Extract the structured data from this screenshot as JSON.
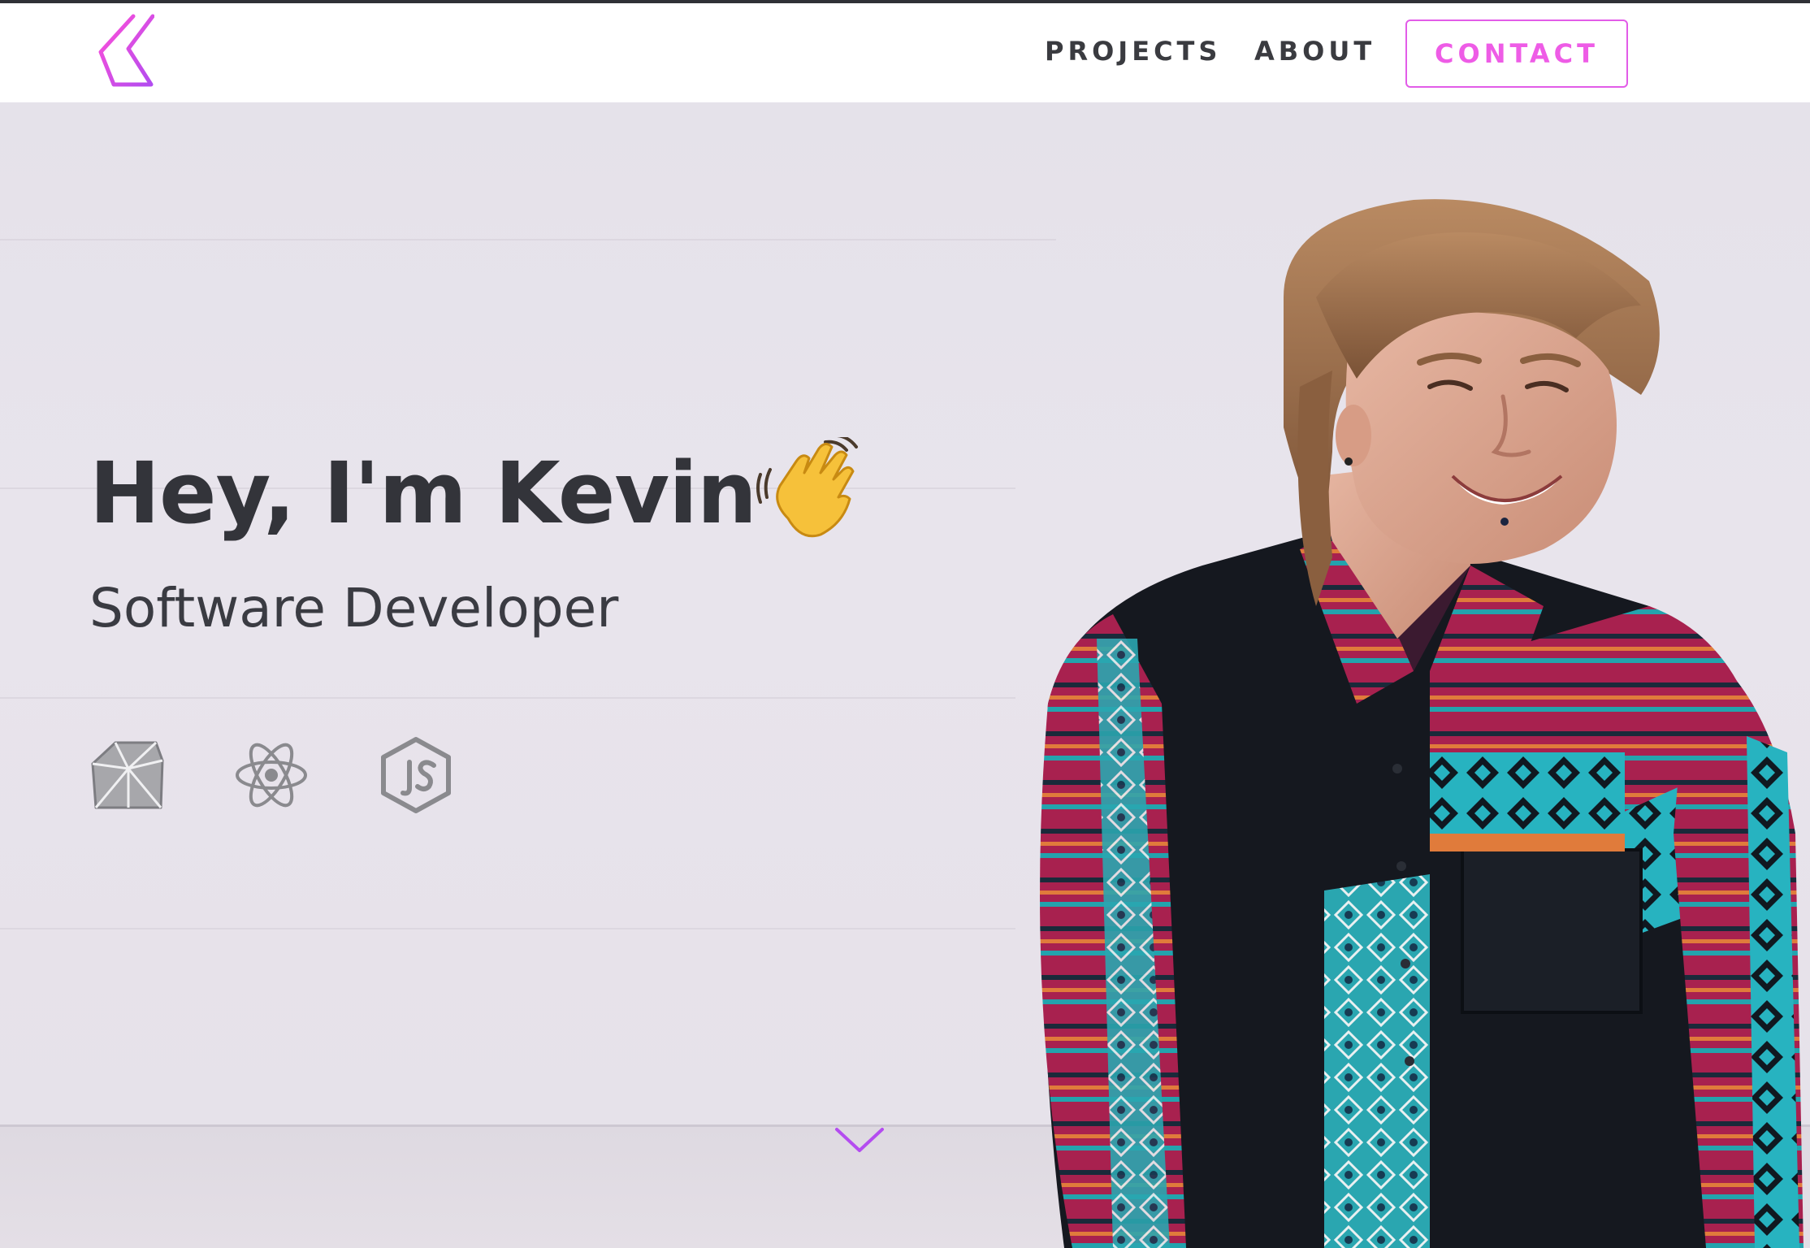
{
  "nav": {
    "logo_icon": "k-logo-icon",
    "links": [
      {
        "label": "PROJECTS"
      },
      {
        "label": "ABOUT"
      }
    ],
    "contact_label": "CONTACT"
  },
  "hero": {
    "title": "Hey, I'm Kevin",
    "emoji_icon": "waving-hand-icon",
    "subtitle": "Software Developer",
    "tech_icons": [
      "ruby-icon",
      "react-icon",
      "nodejs-icon"
    ],
    "scroll_icon": "chevron-down-icon"
  },
  "colors": {
    "accent": "#e25ce8",
    "text_dark": "#33343a",
    "icon_gray": "#8a8a8e",
    "hero_bg": "#e6e2ea"
  }
}
